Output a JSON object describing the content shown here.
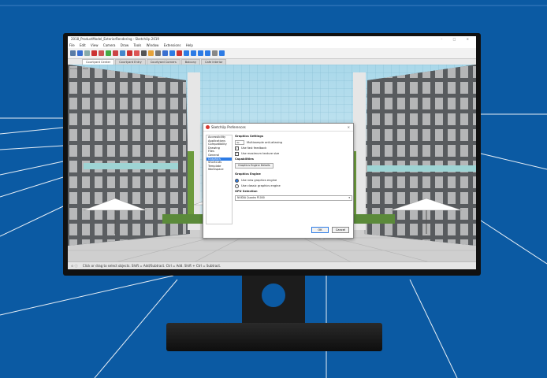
{
  "window": {
    "title": "2018_ProductModel_ExteriorRendering - SketchUp 2019",
    "controls": "– □ ✕"
  },
  "menubar": [
    "File",
    "Edit",
    "View",
    "Camera",
    "Draw",
    "Tools",
    "Window",
    "Extensions",
    "Help"
  ],
  "scene_tabs": [
    "Courtyard Center",
    "Courtyard Entry",
    "Courtyard Corners",
    "Balcony",
    "Cafe Interior"
  ],
  "scene_label": "Courtyard Ptab",
  "dialog": {
    "title": "SketchUp Preferences",
    "close": "✕",
    "sidebar": [
      "Accessibility",
      "Applications",
      "Compatibility",
      "Drawing",
      "Files",
      "General",
      "Graphics",
      "Shortcuts",
      "Template",
      "Workspace"
    ],
    "selected_index": 6,
    "graphics_settings_heading": "Graphics Settings",
    "multisample_value": "4x",
    "multisample_label": "Multisample anti-aliasing",
    "fast_feedback_label": "Use fast feedback",
    "max_texture_label": "Use maximum texture size",
    "capabilities_heading": "Capabilities",
    "graphics_details_button": "Graphics Engine Details",
    "engine_heading": "Graphics Engine",
    "new_engine_label": "Use new graphics engine",
    "classic_engine_label": "Use classic graphics engine",
    "gpu_heading": "GPU Selection",
    "gpu_value": "NVIDIA Quadro P1000",
    "ok_label": "OK",
    "cancel_label": "Cancel"
  },
  "statusbar": {
    "hint": "Click or drag to select objects. Shift = Add/Subtract. Ctrl = Add. Shift + Ctrl = Subtract."
  },
  "colors": {
    "background": "#0b5aa3",
    "accent": "#2c7be5"
  }
}
